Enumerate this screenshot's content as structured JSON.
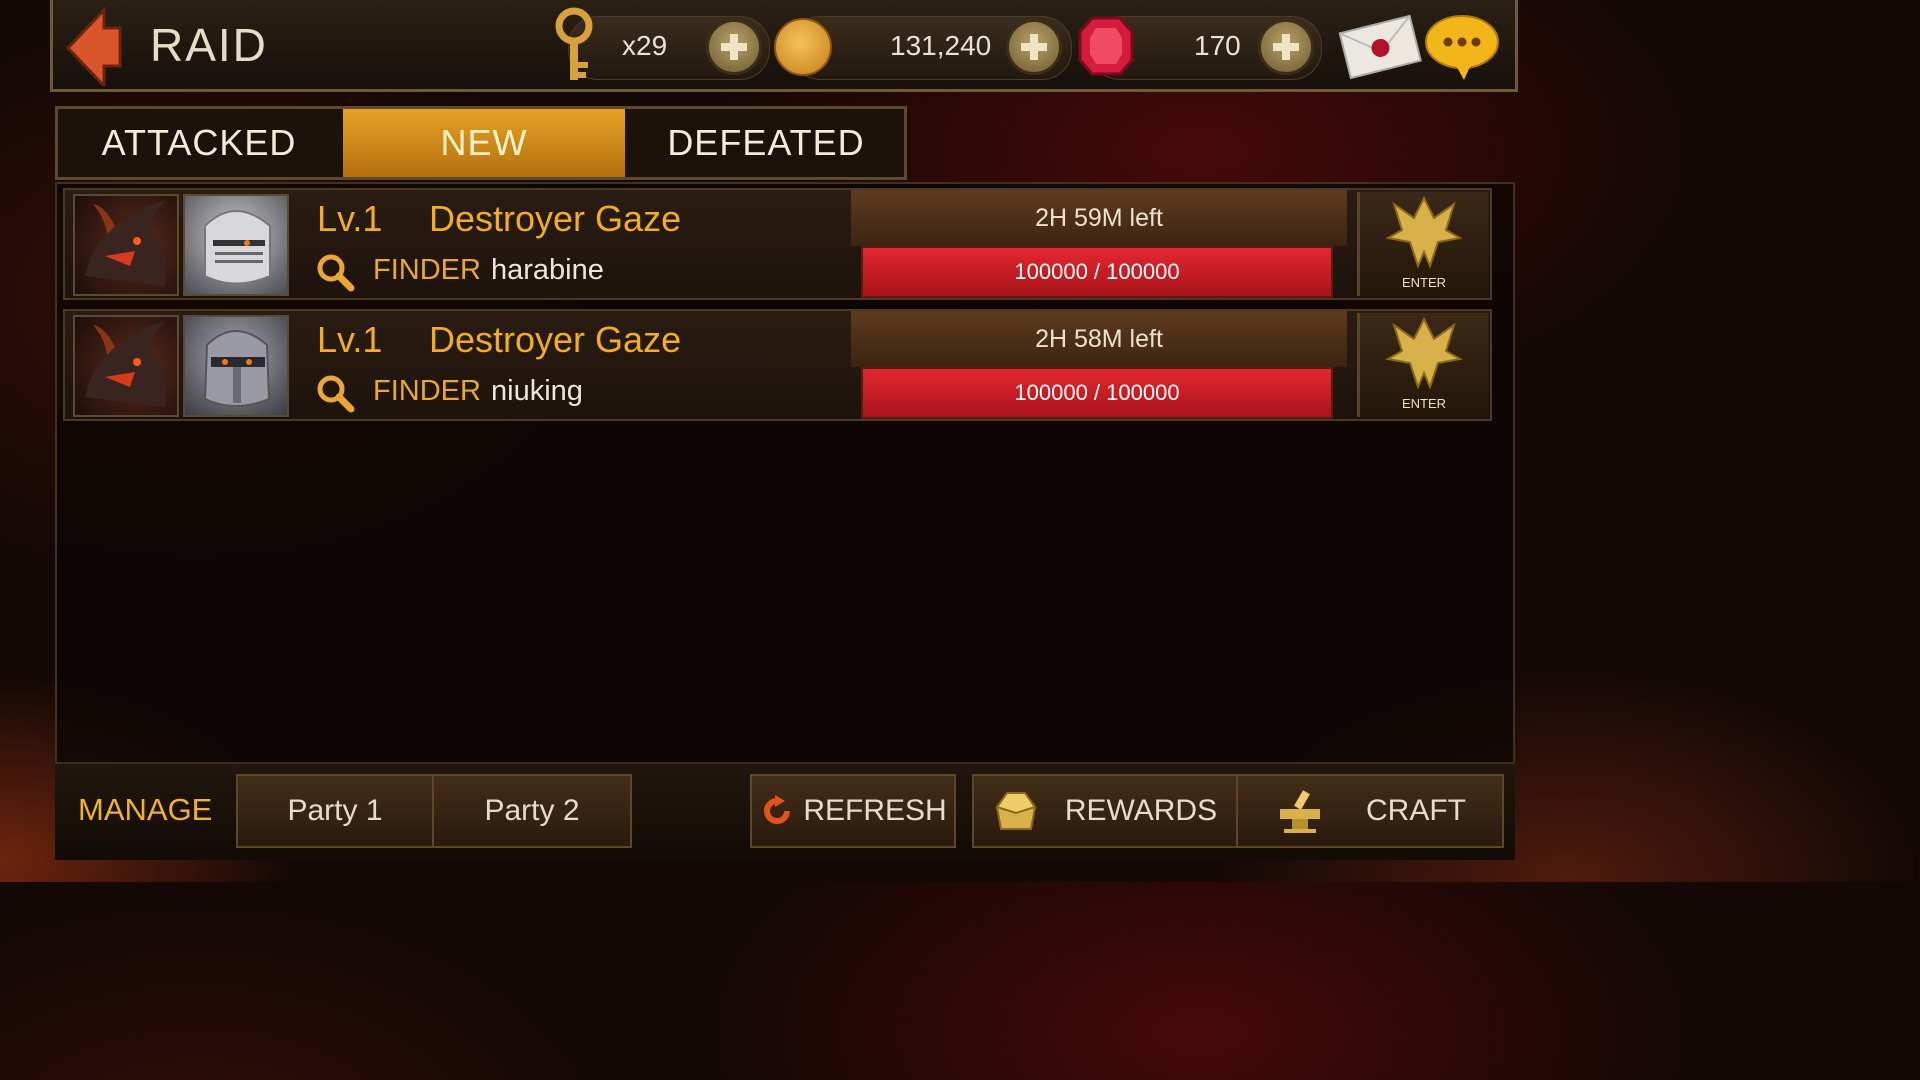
{
  "header": {
    "title": "RAID",
    "keys": "x29",
    "gold": "131,240",
    "gems": "170"
  },
  "tabs": [
    {
      "label": "ATTACKED",
      "active": false
    },
    {
      "label": "NEW",
      "active": true
    },
    {
      "label": "DEFEATED",
      "active": false
    }
  ],
  "raids": [
    {
      "level": "Lv.1",
      "boss": "Destroyer Gaze",
      "finder_label": "FINDER",
      "finder": "harabine",
      "time_left": "2H 59M left",
      "hp": "100000  /  100000",
      "hp_fraction": 1.0,
      "enter": "ENTER"
    },
    {
      "level": "Lv.1",
      "boss": "Destroyer Gaze",
      "finder_label": "FINDER",
      "finder": "niuking",
      "time_left": "2H 58M left",
      "hp": "100000  /  100000",
      "hp_fraction": 1.0,
      "enter": "ENTER"
    }
  ],
  "footer": {
    "manage": "MANAGE",
    "party1": "Party 1",
    "party2": "Party 2",
    "refresh": "REFRESH",
    "rewards": "REWARDS",
    "craft": "CRAFT"
  },
  "colors": {
    "accent": "#f2ad28",
    "tab_active": "#e6a125",
    "hp_red": "#e0242e"
  },
  "icons": [
    "back-arrow-icon",
    "key-icon",
    "gold-coin-icon",
    "ruby-gem-icon",
    "mail-icon",
    "chat-icon",
    "search-icon",
    "dragon-emblem-icon",
    "refresh-icon",
    "rewards-box-icon",
    "craft-anvil-icon"
  ]
}
